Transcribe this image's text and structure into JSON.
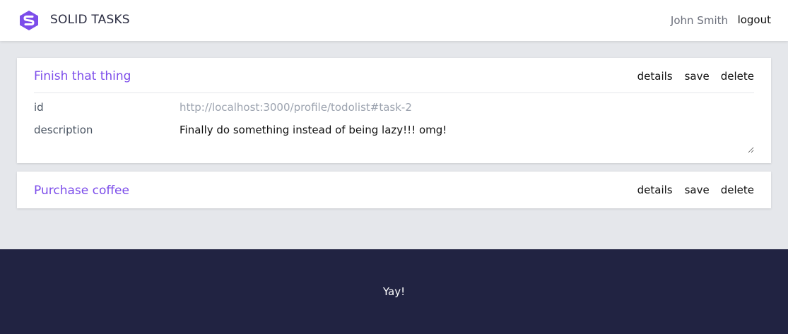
{
  "header": {
    "brand": "SOLID TASKS",
    "user_name": "John Smith",
    "logout_label": "logout",
    "logo_icon": "solid-logo-icon",
    "brand_color": "#8b5cf6"
  },
  "tasks": [
    {
      "title": "Finish that thing",
      "actions": {
        "details": "details",
        "save": "save",
        "delete": "delete"
      },
      "expanded": true,
      "fields": {
        "id_label": "id",
        "id_value": "http://localhost:3000/profile/todolist#task-2",
        "description_label": "description",
        "description_value": "Finally do something instead of being lazy!!! omg!"
      }
    },
    {
      "title": "Purchase coffee",
      "actions": {
        "details": "details",
        "save": "save",
        "delete": "delete"
      },
      "expanded": false
    }
  ],
  "footer": {
    "text": "Yay!"
  },
  "colors": {
    "accent": "#7c4dea",
    "background": "#e5e7eb",
    "footer_bg": "#212342"
  }
}
